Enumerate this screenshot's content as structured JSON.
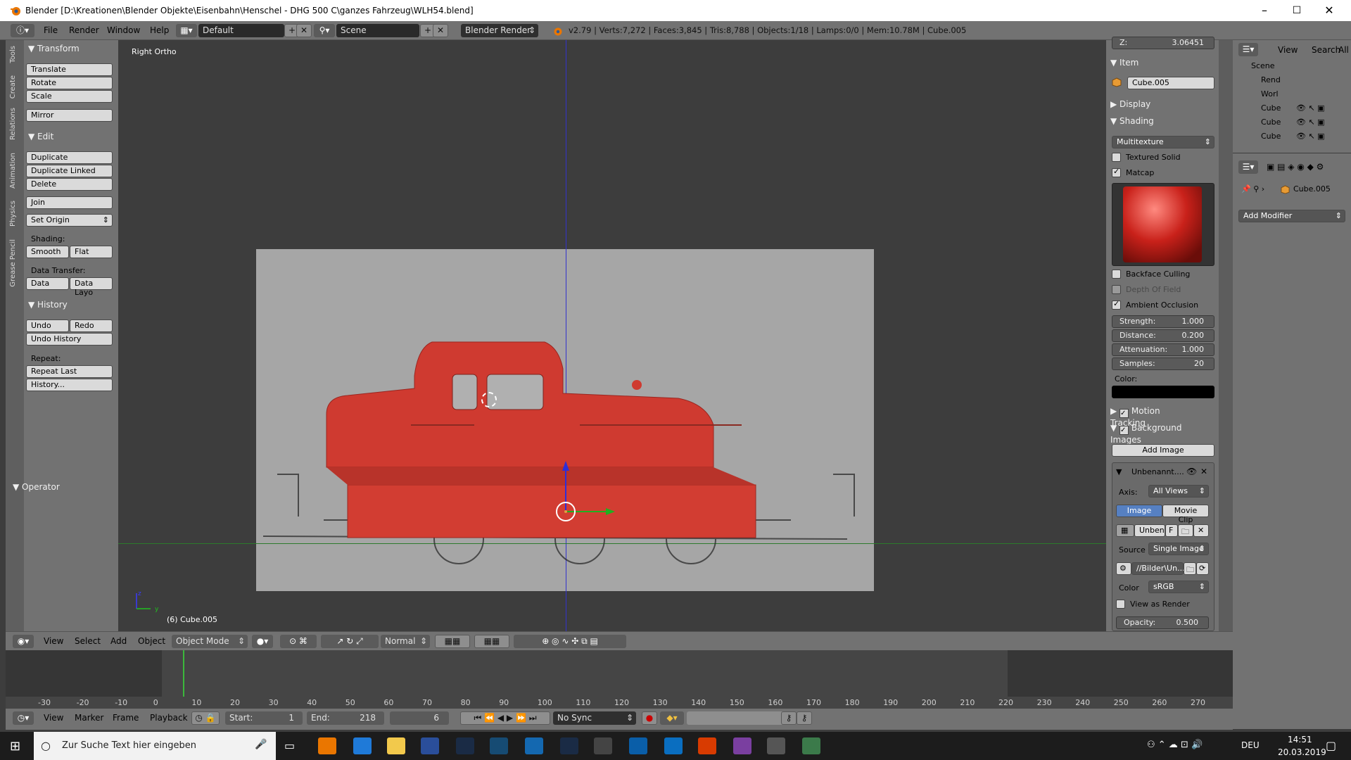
{
  "window": {
    "title": "Blender [D:\\Kreationen\\Blender Objekte\\Eisenbahn\\Henschel - DHG 500 C\\ganzes Fahrzeug\\WLH54.blend]",
    "minimize": "–",
    "maximize": "☐",
    "close": "✕"
  },
  "info_header": {
    "menus": [
      "File",
      "Render",
      "Window",
      "Help"
    ],
    "screen_layout": "Default",
    "scene": "Scene",
    "render_engine": "Blender Render",
    "stats": "v2.79 | Verts:7,272 | Faces:3,845 | Tris:8,788 | Objects:1/18 | Lamps:0/0 | Mem:10.78M | Cube.005"
  },
  "tool_tabs": [
    "Tools",
    "Create",
    "Relations",
    "Animation",
    "Physics",
    "Grease Pencil"
  ],
  "tool_shelf": {
    "transform_title": "Transform",
    "transform_buttons": [
      "Translate",
      "Rotate",
      "Scale",
      "Mirror"
    ],
    "edit_title": "Edit",
    "edit_buttons": [
      "Duplicate",
      "Duplicate Linked",
      "Delete",
      "Join"
    ],
    "set_origin": "Set Origin",
    "shading_label": "Shading:",
    "smooth": "Smooth",
    "flat": "Flat",
    "data_transfer_label": "Data Transfer:",
    "data": "Data",
    "data_layo": "Data Layo",
    "history_title": "History",
    "undo": "Undo",
    "redo": "Redo",
    "undo_history": "Undo History",
    "repeat_label": "Repeat:",
    "repeat_last": "Repeat Last",
    "history_btn": "History...",
    "operator_title": "Operator"
  },
  "viewport": {
    "view_name": "Right Ortho",
    "object_info": "(6) Cube.005",
    "axis_z": "z",
    "axis_y": "y"
  },
  "properties": {
    "top_value_label": "Z:",
    "top_value": "3.06451",
    "item_title": "Item",
    "item_name": "Cube.005",
    "display_title": "Display",
    "shading_title": "Shading",
    "shading_mode": "Multitexture",
    "textured_solid": "Textured Solid",
    "matcap": "Matcap",
    "backface_culling": "Backface Culling",
    "depth_of_field": "Depth Of Field",
    "ambient_occlusion": "Ambient Occlusion",
    "strength_label": "Strength:",
    "strength": "1.000",
    "distance_label": "Distance:",
    "distance": "0.200",
    "attenuation_label": "Attenuation:",
    "attenuation": "1.000",
    "samples_label": "Samples:",
    "samples": "20",
    "color_label": "Color:",
    "motion_tracking": "Motion Tracking",
    "background_images": "Background Images",
    "add_image": "Add Image",
    "bg_name": "Unbenannt....",
    "axis_label": "Axis:",
    "axis_value": "All Views",
    "image_tab": "Image",
    "movie_clip_tab": "Movie Clip",
    "img_field": "Unben",
    "img_f": "F",
    "source_label": "Source",
    "source_value": "Single Image",
    "path": "//Bilder\\Un...",
    "color_space_label": "Color",
    "color_space": "sRGB",
    "view_as_render": "View as Render",
    "opacity_label": "Opacity:",
    "opacity": "0.500"
  },
  "outliner": {
    "view": "View",
    "search": "Search",
    "all": "All",
    "items": [
      "Scene",
      "Rend",
      "Worl",
      "Cube",
      "Cube",
      "Cube"
    ]
  },
  "modifiers": {
    "object": "Cube.005",
    "add_modifier": "Add Modifier"
  },
  "view3d_header": {
    "menus": [
      "View",
      "Select",
      "Add",
      "Object"
    ],
    "mode": "Object Mode",
    "orientation": "Normal"
  },
  "timeline": {
    "ticks": [
      "-30",
      "-20",
      "-10",
      "0",
      "10",
      "20",
      "30",
      "40",
      "50",
      "60",
      "70",
      "80",
      "90",
      "100",
      "110",
      "120",
      "130",
      "140",
      "150",
      "160",
      "170",
      "180",
      "190",
      "200",
      "210",
      "220",
      "230",
      "240",
      "250",
      "260",
      "270"
    ],
    "menus": [
      "View",
      "Marker",
      "Frame",
      "Playback"
    ],
    "start_label": "Start:",
    "start": "1",
    "end_label": "End:",
    "end": "218",
    "current": "6",
    "sync": "No Sync"
  },
  "taskbar": {
    "search_placeholder": "Zur Suche Text hier eingeben",
    "language": "DEU",
    "time": "14:51",
    "date": "20.03.2019"
  }
}
